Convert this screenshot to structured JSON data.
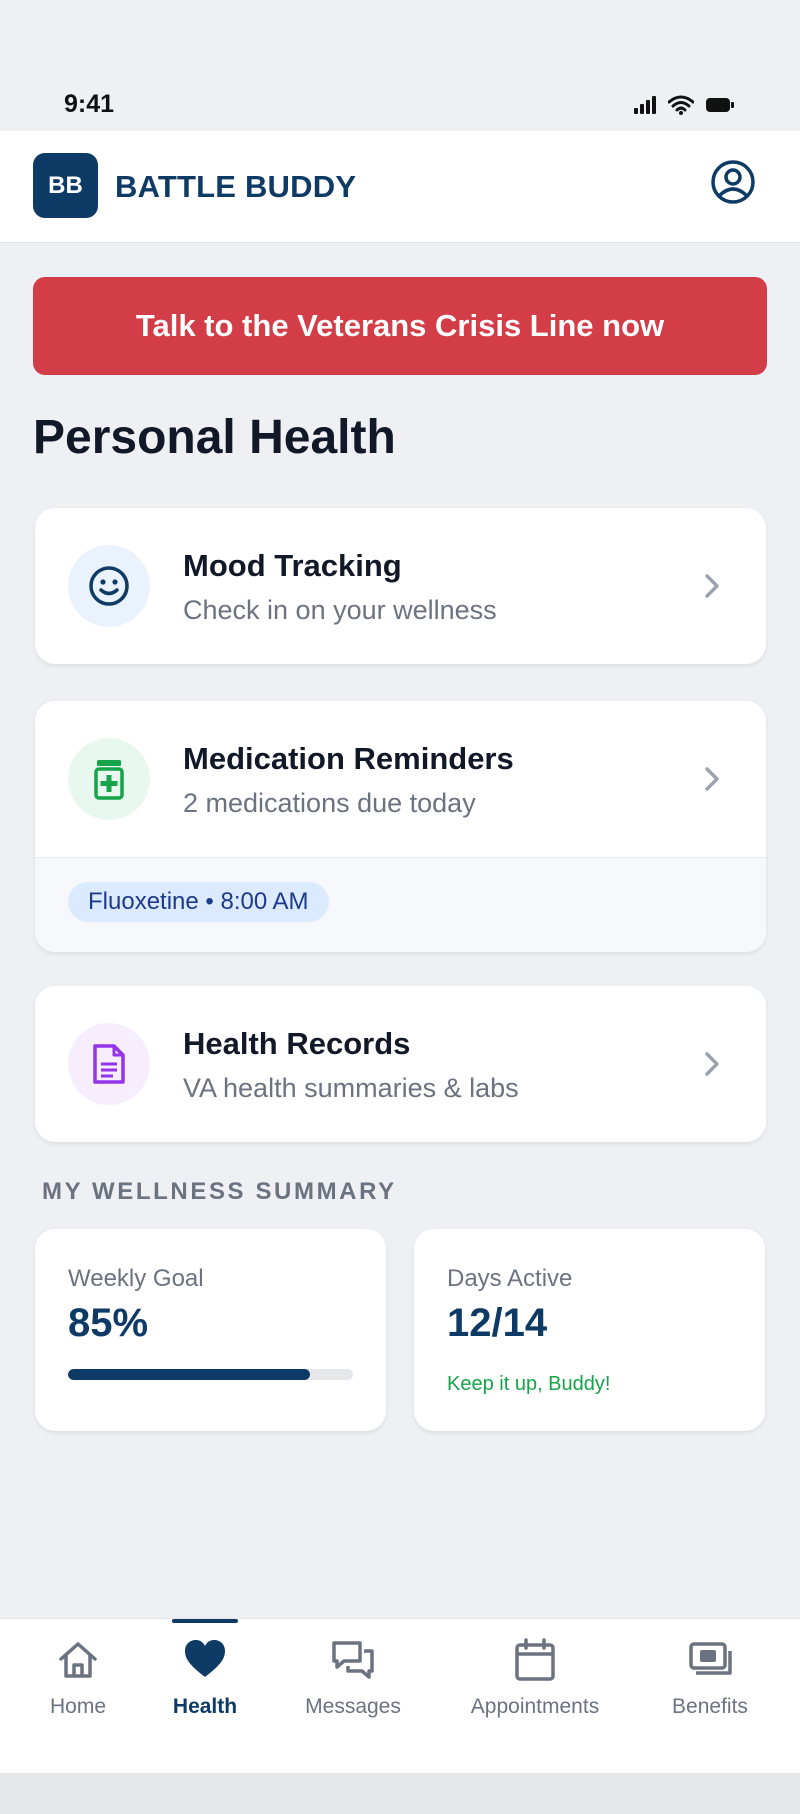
{
  "status_bar": {
    "time": "9:41"
  },
  "header": {
    "logo_initials": "BB",
    "app_title": "BATTLE BUDDY"
  },
  "crisis_button": {
    "label": "Talk to the Veterans Crisis Line now"
  },
  "page": {
    "title": "Personal Health"
  },
  "cards": {
    "mood": {
      "title": "Mood Tracking",
      "subtitle": "Check in on your wellness",
      "icon": "smile-icon",
      "icon_bg": "#eaf3fd",
      "icon_color": "#0e3a66"
    },
    "medication": {
      "title": "Medication Reminders",
      "subtitle": "2 medications due today",
      "icon": "pill-bottle-icon",
      "icon_bg": "#e9f8ee",
      "icon_color": "#16a34a",
      "reminder": "Fluoxetine • 8:00 AM"
    },
    "records": {
      "title": "Health Records",
      "subtitle": "VA health summaries & labs",
      "icon": "document-icon",
      "icon_bg": "#f7eefd",
      "icon_color": "#9333ea"
    }
  },
  "wellness": {
    "section_label": "MY WELLNESS SUMMARY",
    "weekly_goal": {
      "label": "Weekly Goal",
      "value": "85%",
      "progress": 0.85
    },
    "days_active": {
      "label": "Days Active",
      "value": "12/14",
      "note": "Keep it up, Buddy!"
    }
  },
  "tabs": [
    {
      "label": "Home",
      "icon": "home-icon",
      "active": false
    },
    {
      "label": "Health",
      "icon": "heart-icon",
      "active": true
    },
    {
      "label": "Messages",
      "icon": "messages-icon",
      "active": false
    },
    {
      "label": "Appointments",
      "icon": "calendar-icon",
      "active": false
    },
    {
      "label": "Benefits",
      "icon": "money-icon",
      "active": false
    }
  ],
  "colors": {
    "brand": "#0e3a66",
    "crisis": "#d23d48",
    "success": "#16a34a",
    "background": "#eff0f4"
  }
}
